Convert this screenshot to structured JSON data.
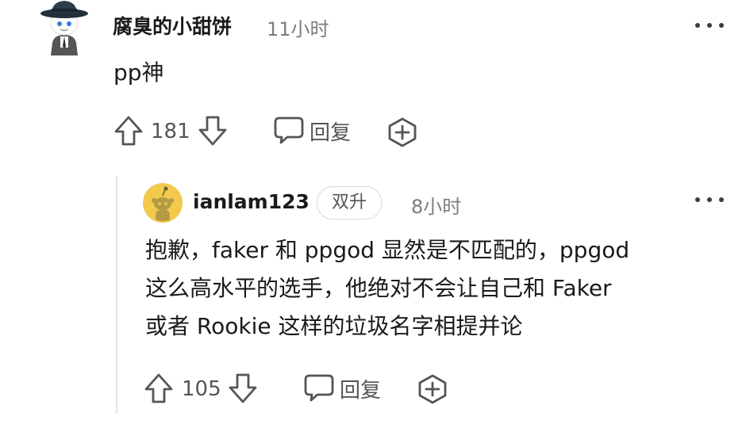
{
  "parent_comment": {
    "username": "腐臭的小甜饼",
    "timestamp": "11小时",
    "body": "pp神",
    "upvotes": "181",
    "reply_label": "回复"
  },
  "reply_comment": {
    "username": "ianlam123",
    "flair": "双升",
    "timestamp": "8小时",
    "body_lines": [
      "抱歉，faker 和 ppgod 显然是不匹配的，ppgod",
      "这么高水平的选手，他绝对不会让自己和 Faker",
      "或者 Rookie 这样的垃圾名字相提并论"
    ],
    "upvotes": "105",
    "reply_label": "回复"
  },
  "colors": {
    "text": "#1a1a1b",
    "meta": "#7c7c7c",
    "icon": "#555555",
    "flair_border": "#d8d8d8",
    "reply_avatar_bg": "#f2c94c"
  }
}
